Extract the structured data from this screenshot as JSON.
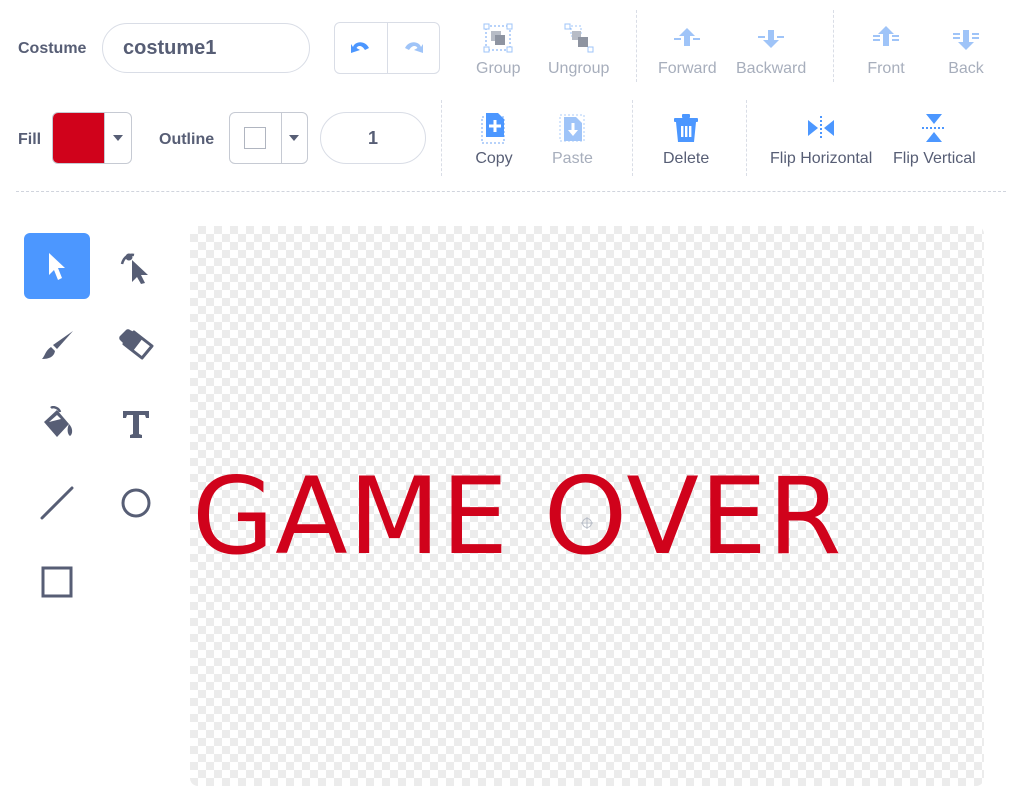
{
  "costume": {
    "label": "Costume",
    "name_value": "costume1",
    "undo_icon": "undo-icon",
    "redo_icon": "redo-icon"
  },
  "toolbar": {
    "group": "Group",
    "ungroup": "Ungroup",
    "forward": "Forward",
    "backward": "Backward",
    "front": "Front",
    "back": "Back",
    "copy": "Copy",
    "paste": "Paste",
    "delete": "Delete",
    "flip_horizontal": "Flip Horizontal",
    "flip_vertical": "Flip Vertical"
  },
  "fill": {
    "label": "Fill",
    "color": "#d0021b"
  },
  "outline": {
    "label": "Outline",
    "color": "#ffffff",
    "width_value": "1"
  },
  "tools": [
    {
      "name": "select",
      "icon": "select-arrow-icon",
      "active": true
    },
    {
      "name": "reshape",
      "icon": "reshape-icon",
      "active": false
    },
    {
      "name": "brush",
      "icon": "brush-icon",
      "active": false
    },
    {
      "name": "eraser",
      "icon": "eraser-icon",
      "active": false
    },
    {
      "name": "fill",
      "icon": "paint-bucket-icon",
      "active": false
    },
    {
      "name": "text",
      "icon": "text-icon",
      "active": false
    },
    {
      "name": "line",
      "icon": "line-icon",
      "active": false
    },
    {
      "name": "circle",
      "icon": "circle-icon",
      "active": false
    },
    {
      "name": "rectangle",
      "icon": "rectangle-icon",
      "active": false
    }
  ],
  "canvas": {
    "text": "GAME OVER",
    "text_color": "#d0021b"
  },
  "colors": {
    "accent": "#4c97ff",
    "text": "#575e75",
    "disabled": "#a7aebc",
    "danger_icon": "#4c97ff"
  }
}
